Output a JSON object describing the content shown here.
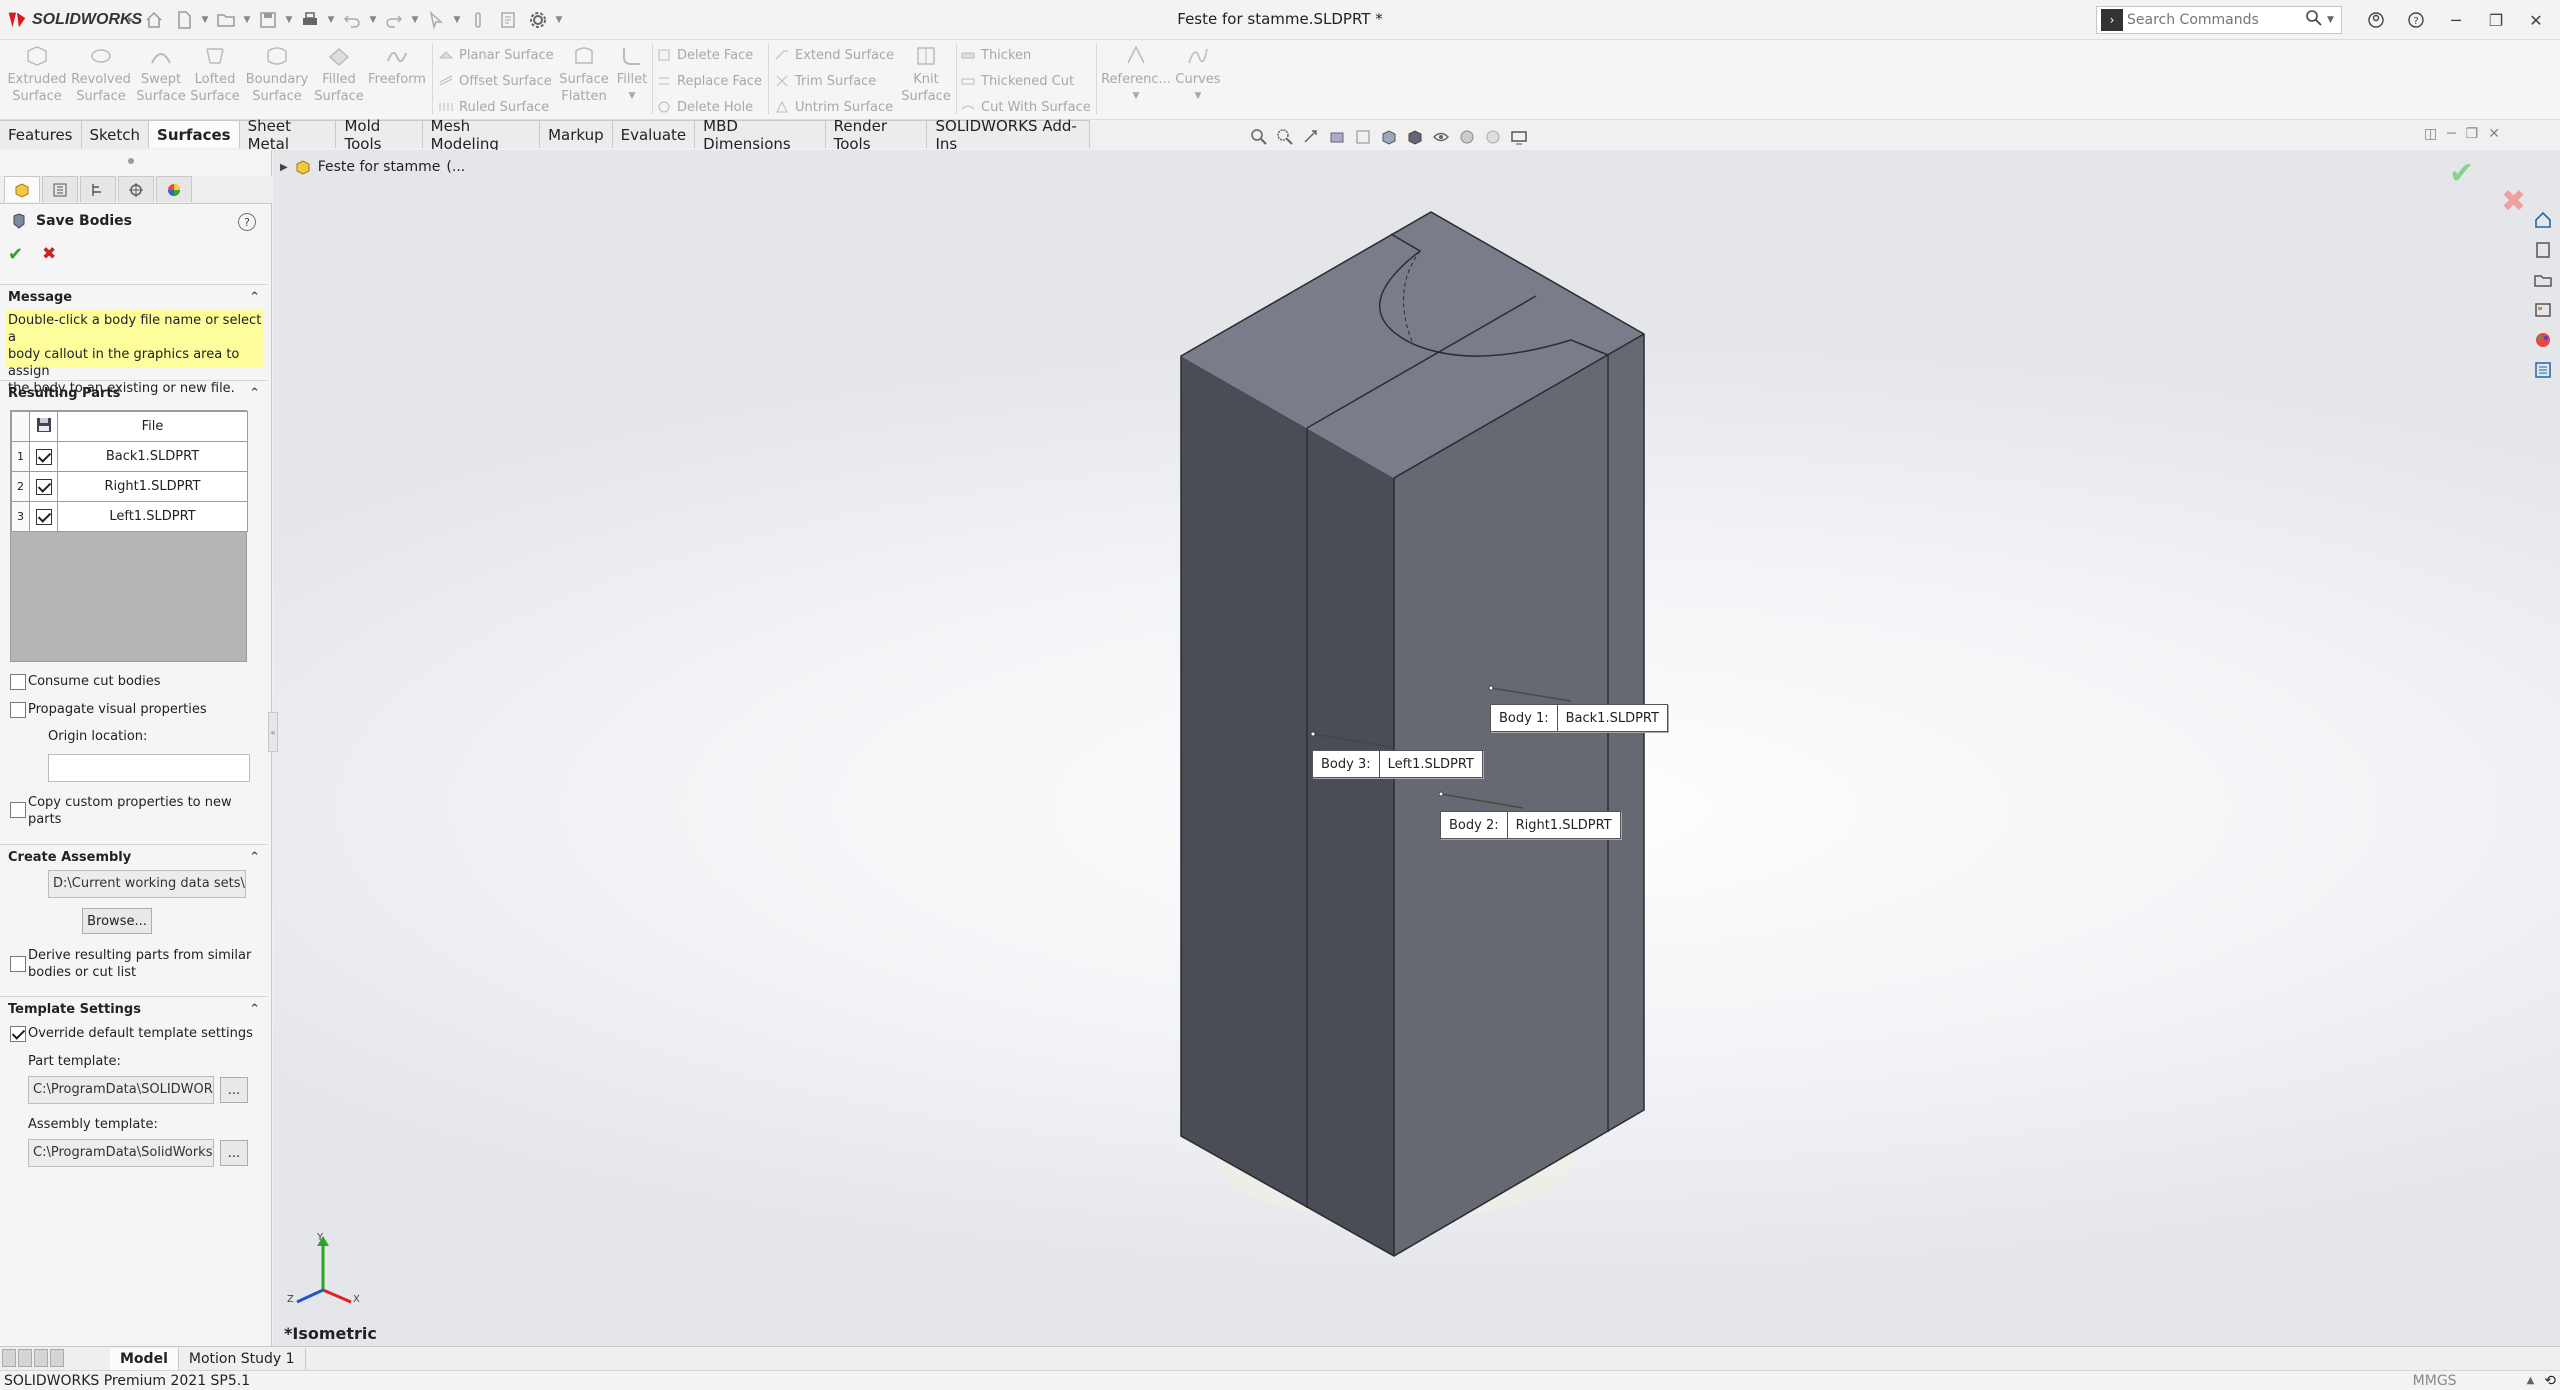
{
  "app": {
    "name": "SOLIDWORKS",
    "brand_color": "#d71920"
  },
  "title_bar": {
    "document_title": "Feste for stamme.SLDPRT *"
  },
  "search": {
    "placeholder": "Search Commands"
  },
  "ribbon": {
    "big_buttons": [
      {
        "label1": "Extruded",
        "label2": "Surface",
        "icon": "extrude-icon"
      },
      {
        "label1": "Revolved",
        "label2": "Surface",
        "icon": "revolve-icon"
      },
      {
        "label1": "Swept",
        "label2": "Surface",
        "icon": "sweep-icon"
      },
      {
        "label1": "Lofted",
        "label2": "Surface",
        "icon": "loft-icon"
      },
      {
        "label1": "Boundary",
        "label2": "Surface",
        "icon": "boundary-icon"
      },
      {
        "label1": "Filled",
        "label2": "Surface",
        "icon": "fill-icon"
      },
      {
        "label1": "Freeform",
        "label2": "",
        "icon": "freeform-icon"
      }
    ],
    "group2": [
      "Planar Surface",
      "Offset Surface",
      "Ruled Surface"
    ],
    "group2_big": [
      {
        "label1": "Surface",
        "label2": "Flatten"
      },
      {
        "label1": "Fillet",
        "label2": ""
      }
    ],
    "group3": [
      "Delete Face",
      "Replace Face",
      "Delete Hole"
    ],
    "group4": [
      "Extend Surface",
      "Trim Surface",
      "Untrim Surface"
    ],
    "group4_big": {
      "label1": "Knit",
      "label2": "Surface"
    },
    "group5": [
      "Thicken",
      "Thickened Cut",
      "Cut With Surface"
    ],
    "group6": [
      {
        "label1": "Referenc...",
        "label2": ""
      },
      {
        "label1": "Curves",
        "label2": ""
      }
    ]
  },
  "tabs": [
    "Features",
    "Sketch",
    "Surfaces",
    "Sheet Metal",
    "Mold Tools",
    "Mesh Modeling",
    "Markup",
    "Evaluate",
    "MBD Dimensions",
    "Render Tools",
    "SOLIDWORKS Add-Ins"
  ],
  "active_tab": "Surfaces",
  "panel": {
    "title": "Save Bodies",
    "message_header": "Message",
    "message_lines": [
      "Double-click a body file name or select a",
      "body callout in the graphics area to assign",
      "the body to an existing or new file."
    ],
    "resulting_parts_header": "Resulting Parts",
    "table_header": "File",
    "rows": [
      {
        "num": "1",
        "file": "Back1.SLDPRT"
      },
      {
        "num": "2",
        "file": "Right1.SLDPRT"
      },
      {
        "num": "3",
        "file": "Left1.SLDPRT"
      }
    ],
    "consume_cut_bodies": "Consume cut bodies",
    "propagate_visual": "Propagate visual properties",
    "origin_location": "Origin location:",
    "copy_custom_1": "Copy custom properties to new",
    "copy_custom_2": "parts",
    "create_assembly_header": "Create Assembly",
    "assembly_path": "D:\\Current working data sets\\Bik",
    "browse": "Browse...",
    "derive_1": "Derive resulting parts from similar",
    "derive_2": "bodies or cut list",
    "template_header": "Template Settings",
    "override_template": "Override default template settings",
    "part_template_label": "Part template:",
    "part_template_path": "C:\\ProgramData\\SOLIDWORKS",
    "assembly_template_label": "Assembly template:",
    "assembly_template_path": "C:\\ProgramData\\SolidWorks\\S(",
    "ellipsis": "..."
  },
  "tree": {
    "root": "Feste for stamme",
    "suffix": "(..."
  },
  "view": {
    "orientation": "*Isometric"
  },
  "callouts": [
    {
      "body": "Body   1:",
      "file": "Back1.SLDPRT"
    },
    {
      "body": "Body   3:",
      "file": "Left1.SLDPRT"
    },
    {
      "body": "Body   2:",
      "file": "Right1.SLDPRT"
    }
  ],
  "bottom_tabs": [
    "Model",
    "Motion Study 1"
  ],
  "status": {
    "version": "SOLIDWORKS Premium 2021 SP5.1",
    "units": "MMGS"
  }
}
